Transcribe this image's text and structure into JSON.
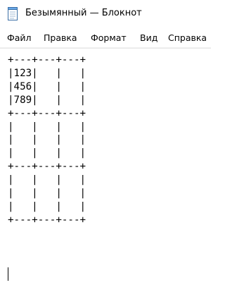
{
  "window": {
    "title": "Безымянный — Блокнот",
    "icon": "notepad-icon"
  },
  "menu": {
    "file": "Файл",
    "edit": "Правка",
    "format": "Формат",
    "view": "Вид",
    "help": "Справка"
  },
  "editor": {
    "content": "+---+---+---+\n|123|   |   |\n|456|   |   |\n|789|   |   |\n+---+---+---+\n|   |   |   |\n|   |   |   |\n|   |   |   |\n+---+---+---+\n|   |   |   |\n|   |   |   |\n|   |   |   |\n+---+---+---+"
  }
}
